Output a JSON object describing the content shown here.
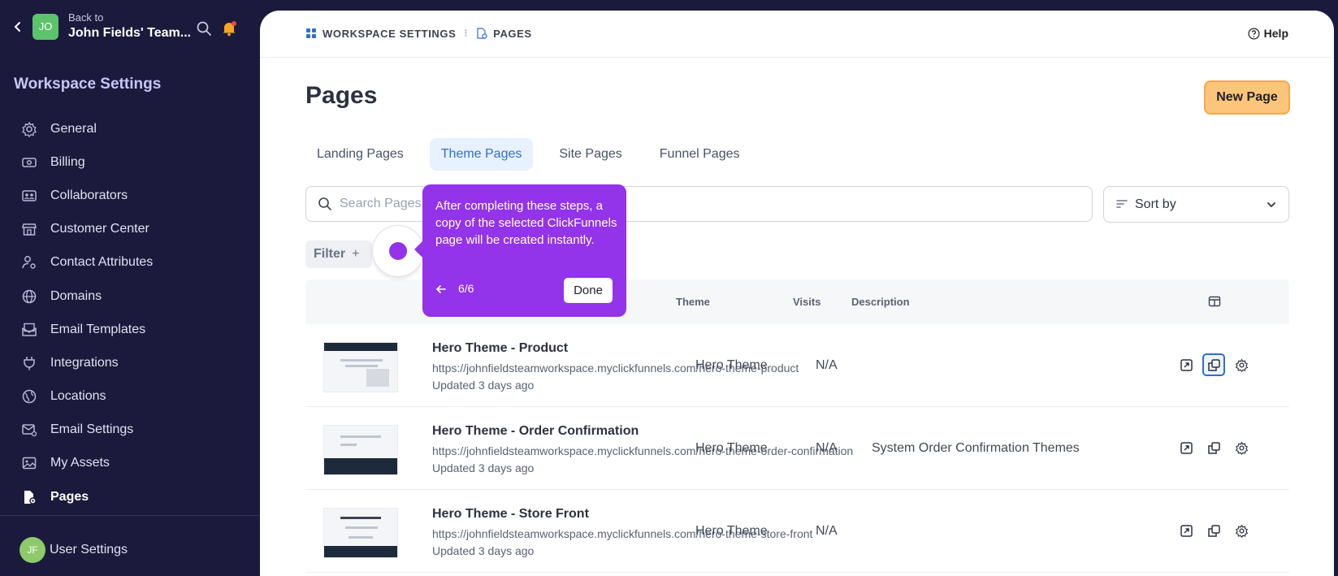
{
  "sidebar": {
    "back_to": "Back to",
    "team_name": "John Fields' Team...",
    "team_initials": "JO",
    "heading": "Workspace Settings",
    "items": [
      {
        "label": "General",
        "icon": "gear-icon"
      },
      {
        "label": "Billing",
        "icon": "money-icon"
      },
      {
        "label": "Collaborators",
        "icon": "people-icon"
      },
      {
        "label": "Customer Center",
        "icon": "store-icon"
      },
      {
        "label": "Contact Attributes",
        "icon": "user-settings-icon"
      },
      {
        "label": "Domains",
        "icon": "globe-icon"
      },
      {
        "label": "Email Templates",
        "icon": "mail-template-icon"
      },
      {
        "label": "Integrations",
        "icon": "plug-icon"
      },
      {
        "label": "Locations",
        "icon": "location-globe-icon"
      },
      {
        "label": "Email Settings",
        "icon": "mail-settings-icon"
      },
      {
        "label": "My Assets",
        "icon": "image-icon"
      },
      {
        "label": "Pages",
        "icon": "file-gear-icon"
      }
    ],
    "user_initials": "JF",
    "user_settings": "User Settings"
  },
  "breadcrumb": {
    "root": "WORKSPACE SETTINGS",
    "current": "PAGES"
  },
  "help_label": "Help",
  "page_title": "Pages",
  "new_page_label": "New Page",
  "tabs": [
    {
      "label": "Landing Pages",
      "active": false
    },
    {
      "label": "Theme Pages",
      "active": true
    },
    {
      "label": "Site Pages",
      "active": false
    },
    {
      "label": "Funnel Pages",
      "active": false
    }
  ],
  "search": {
    "placeholder": "Search Pages"
  },
  "sort_label": "Sort by",
  "filter_label": "Filter",
  "filter_plus": "+",
  "table": {
    "headers": {
      "theme": "Theme",
      "visits": "Visits",
      "description": "Description"
    },
    "rows": [
      {
        "name": "Hero Theme - Product",
        "url": "https://johnfieldsteamworkspace.myclickfunnels.com/hero-theme-product",
        "updated": "Updated 3 days ago",
        "theme": "Hero Theme",
        "visits": "N/A",
        "description": ""
      },
      {
        "name": "Hero Theme - Order Confirmation",
        "url": "https://johnfieldsteamworkspace.myclickfunnels.com/hero-theme-order-confirmation",
        "updated": "Updated 3 days ago",
        "theme": "Hero Theme",
        "visits": "N/A",
        "description": "System Order Confirmation Themes"
      },
      {
        "name": "Hero Theme - Store Front",
        "url": "https://johnfieldsteamworkspace.myclickfunnels.com/hero-theme-store-front",
        "updated": "Updated 3 days ago",
        "theme": "Hero Theme",
        "visits": "N/A",
        "description": ""
      }
    ]
  },
  "tour": {
    "text": "After completing these steps, a copy of the selected ClickFunnels page will be created instantly.",
    "step": "6/6",
    "done_label": "Done"
  },
  "colors": {
    "sidebar_bg": "#1b1a3d",
    "accent": "#9333ea",
    "active_tab": "#2e6fd1",
    "new_page_bg": "#fdc57c"
  }
}
